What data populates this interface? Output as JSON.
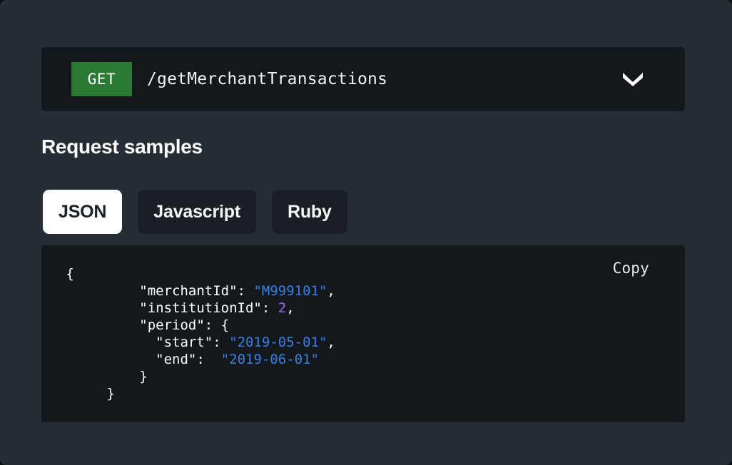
{
  "endpoint": {
    "method": "GET",
    "path": "/getMerchantTransactions",
    "expand_icon": "chevron-down-icon"
  },
  "section": {
    "title": "Request samples"
  },
  "tabs": [
    {
      "label": "JSON",
      "active": true
    },
    {
      "label": "Javascript",
      "active": false
    },
    {
      "label": "Ruby",
      "active": false
    }
  ],
  "code_panel": {
    "copy_label": "Copy",
    "language": "JSON",
    "lines": [
      {
        "indent": 3,
        "parts": [
          {
            "t": "{",
            "c": "pun"
          }
        ]
      },
      {
        "indent": 12,
        "parts": [
          {
            "t": "\"merchantId\"",
            "c": "key"
          },
          {
            "t": ": ",
            "c": "pun"
          },
          {
            "t": "\"M999101\"",
            "c": "str"
          },
          {
            "t": ",",
            "c": "pun"
          }
        ]
      },
      {
        "indent": 12,
        "parts": [
          {
            "t": "\"institutionId\"",
            "c": "key"
          },
          {
            "t": ": ",
            "c": "pun"
          },
          {
            "t": "2",
            "c": "num"
          },
          {
            "t": ",",
            "c": "pun"
          }
        ]
      },
      {
        "indent": 12,
        "parts": [
          {
            "t": "\"period\"",
            "c": "key"
          },
          {
            "t": ": {",
            "c": "pun"
          }
        ]
      },
      {
        "indent": 14,
        "parts": [
          {
            "t": "\"start\"",
            "c": "key"
          },
          {
            "t": ": ",
            "c": "pun"
          },
          {
            "t": "\"2019-05-01\"",
            "c": "str"
          },
          {
            "t": ",",
            "c": "pun"
          }
        ]
      },
      {
        "indent": 14,
        "parts": [
          {
            "t": "\"end\"",
            "c": "key"
          },
          {
            "t": ":  ",
            "c": "pun"
          },
          {
            "t": "\"2019-06-01\"",
            "c": "str"
          }
        ]
      },
      {
        "indent": 12,
        "parts": [
          {
            "t": "}",
            "c": "pun"
          }
        ]
      },
      {
        "indent": 8,
        "parts": [
          {
            "t": "}",
            "c": "pun"
          }
        ]
      }
    ]
  },
  "colors": {
    "page_background": "#252e35",
    "panel_background": "#12181c",
    "method_get": "#2a7a34",
    "tab_active_background": "#ffffff",
    "tab_inactive_background": "#191f25",
    "string_token": "#3b7fe0",
    "number_token": "#9d6ce8",
    "text": "#ffffff"
  }
}
